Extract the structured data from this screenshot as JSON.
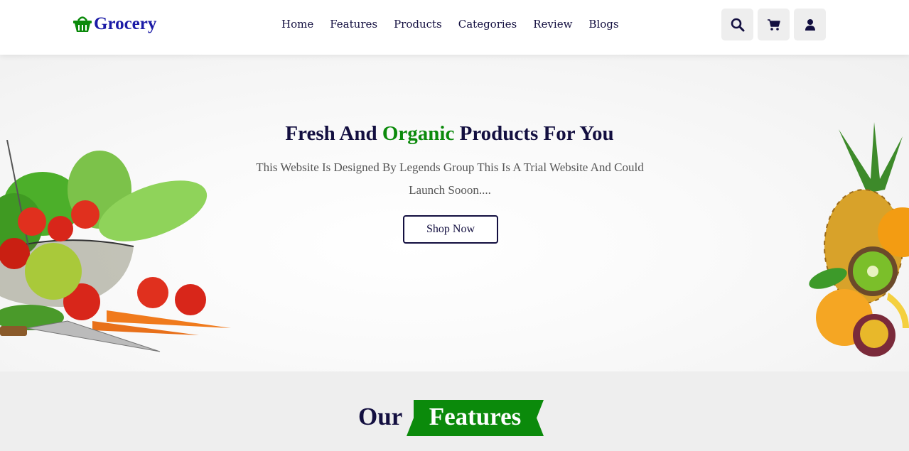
{
  "header": {
    "logo_text": "Grocery",
    "nav": [
      {
        "label": "Home"
      },
      {
        "label": "Features"
      },
      {
        "label": "Products"
      },
      {
        "label": "Categories"
      },
      {
        "label": "Review"
      },
      {
        "label": "Blogs"
      }
    ],
    "icons": [
      "search-icon",
      "cart-icon",
      "user-icon"
    ]
  },
  "hero": {
    "title_before": "Fresh And ",
    "title_accent": "Organic",
    "title_after": " Products For You",
    "description": "This Website Is Designed By Legends Group This Is A Trial Website And Could Launch Sooon....",
    "button_label": "Shop Now"
  },
  "features": {
    "heading_prefix": "Our",
    "heading_highlight": "Features"
  },
  "colors": {
    "brand_dark": "#130f40",
    "accent_green": "#0b8a0b",
    "logo_blue": "#1a1aa6",
    "icon_bg": "#eeeeee"
  }
}
